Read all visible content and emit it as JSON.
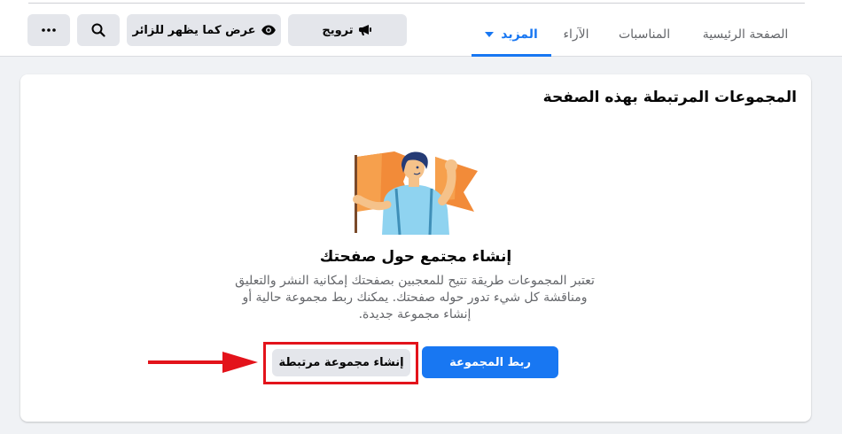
{
  "nav": {
    "tabs": [
      {
        "label": "الصفحة الرئيسية"
      },
      {
        "label": "المناسبات"
      },
      {
        "label": "الآراء"
      },
      {
        "label": "المزيد"
      }
    ],
    "promote_label": "ترويج",
    "view_as_visitor_label": "عرض كما يظهر للزائر",
    "search_icon": "search-icon",
    "more_icon": "more-dots-icon",
    "accent_color": "#1877f2"
  },
  "card": {
    "title": "المجموعات المرتبطة بهذه الصفحة",
    "headline": "إنشاء مجتمع حول صفحتك",
    "description": "تعتبر المجموعات طريقة تتيح للمعجبين بصفحتك إمكانية النشر والتعليق ومناقشة كل شيء تدور حوله صفحتك. يمكنك ربط مجموعة حالية أو إنشاء مجموعة جديدة.",
    "link_group_label": "ربط المجموعة",
    "create_group_label": "إنشاء مجموعة مرتبطة"
  },
  "annotation": {
    "highlight_color": "#e3131b"
  }
}
